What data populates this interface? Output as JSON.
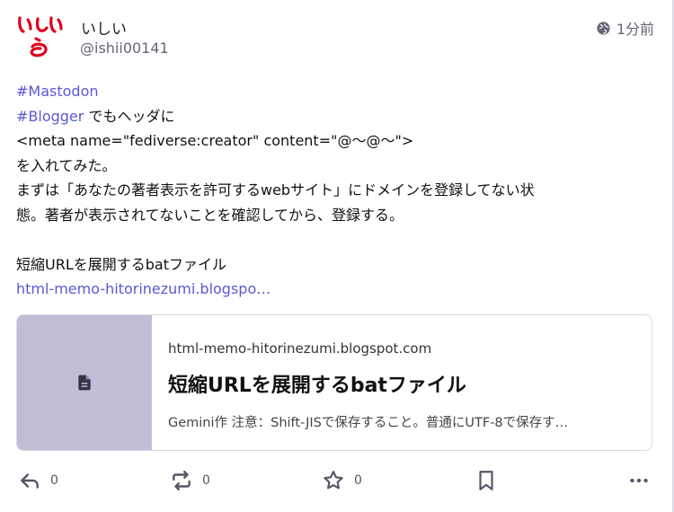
{
  "author": {
    "display_name": "いしい",
    "handle": "@ishii00141",
    "avatar_text": "いしい"
  },
  "timestamp": {
    "text": "1分前",
    "icon": "globe-icon"
  },
  "content": {
    "hashtag1": "#Mastodon",
    "hashtag2": "#Blogger",
    "line2_suffix": " でもヘッダに",
    "line3": "<meta name=\"fediverse:creator\" content=\"@～@～\">",
    "line4": "を入れてみた。",
    "line5": "まずは「あなたの著者表示を許可するwebサイト」にドメインを登録してない状",
    "line6": "態。著者が表示されてないことを確認してから、登録する。",
    "line8": "短縮URLを展開するbatファイル",
    "link_text": "html-memo-hitorinezumi.blogspo…"
  },
  "card": {
    "domain": "html-memo-hitorinezumi.blogspot.com",
    "title": "短縮URLを展開するbatファイル",
    "description": "Gemini作 注意：Shift-JISで保存すること。普通にUTF-8で保存す…",
    "thumb_icon": "document-icon"
  },
  "actions": {
    "reply_count": "0",
    "boost_count": "0",
    "favourite_count": "0"
  },
  "colors": {
    "accent": "#5a58d6",
    "card_thumb_bg": "#c2bdd6",
    "avatar_red": "#e0001a"
  }
}
